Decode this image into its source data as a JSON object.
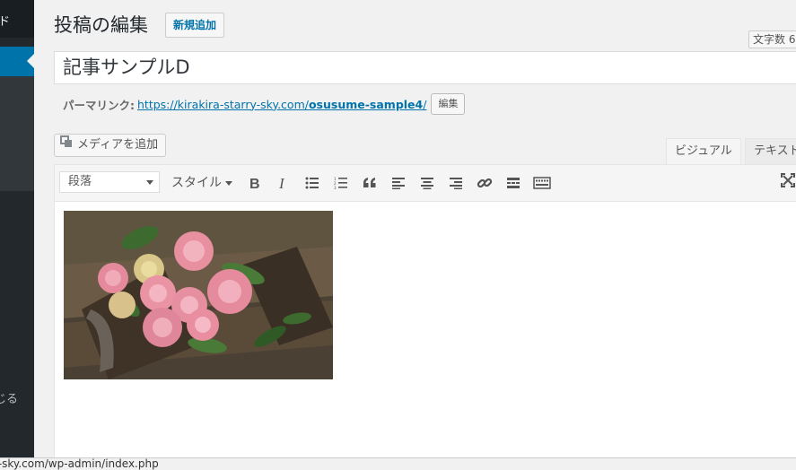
{
  "sidebar": {
    "top_label": "ド",
    "bottom_label": "じる"
  },
  "header": {
    "title": "投稿の編集",
    "add_new": "新規追加"
  },
  "wordcount": "文字数 6",
  "post": {
    "title": "記事サンプルD"
  },
  "permalink": {
    "label": "パーマリンク:",
    "url_base": "https://kirakira-starry-sky.com/",
    "slug": "osusume-sample4",
    "trailing_slash": "/",
    "edit_button": "編集"
  },
  "media_button": "メディアを追加",
  "tabs": {
    "visual": "ビジュアル",
    "text": "テキスト"
  },
  "toolbar": {
    "format_value": "段落",
    "style_label": "スタイル",
    "buttons": [
      "bold-icon",
      "italic-icon",
      "bullet-list-icon",
      "numbered-list-icon",
      "blockquote-icon",
      "align-left-icon",
      "align-center-icon",
      "align-right-icon",
      "link-icon",
      "read-more-icon",
      "toolbar-toggle-icon",
      "fullscreen-icon"
    ]
  },
  "colors": {
    "sidebar": "#23282d",
    "sidebar_active": "#0073aa",
    "link": "#0073aa"
  },
  "status_url": "ry-sky.com/wp-admin/index.php"
}
